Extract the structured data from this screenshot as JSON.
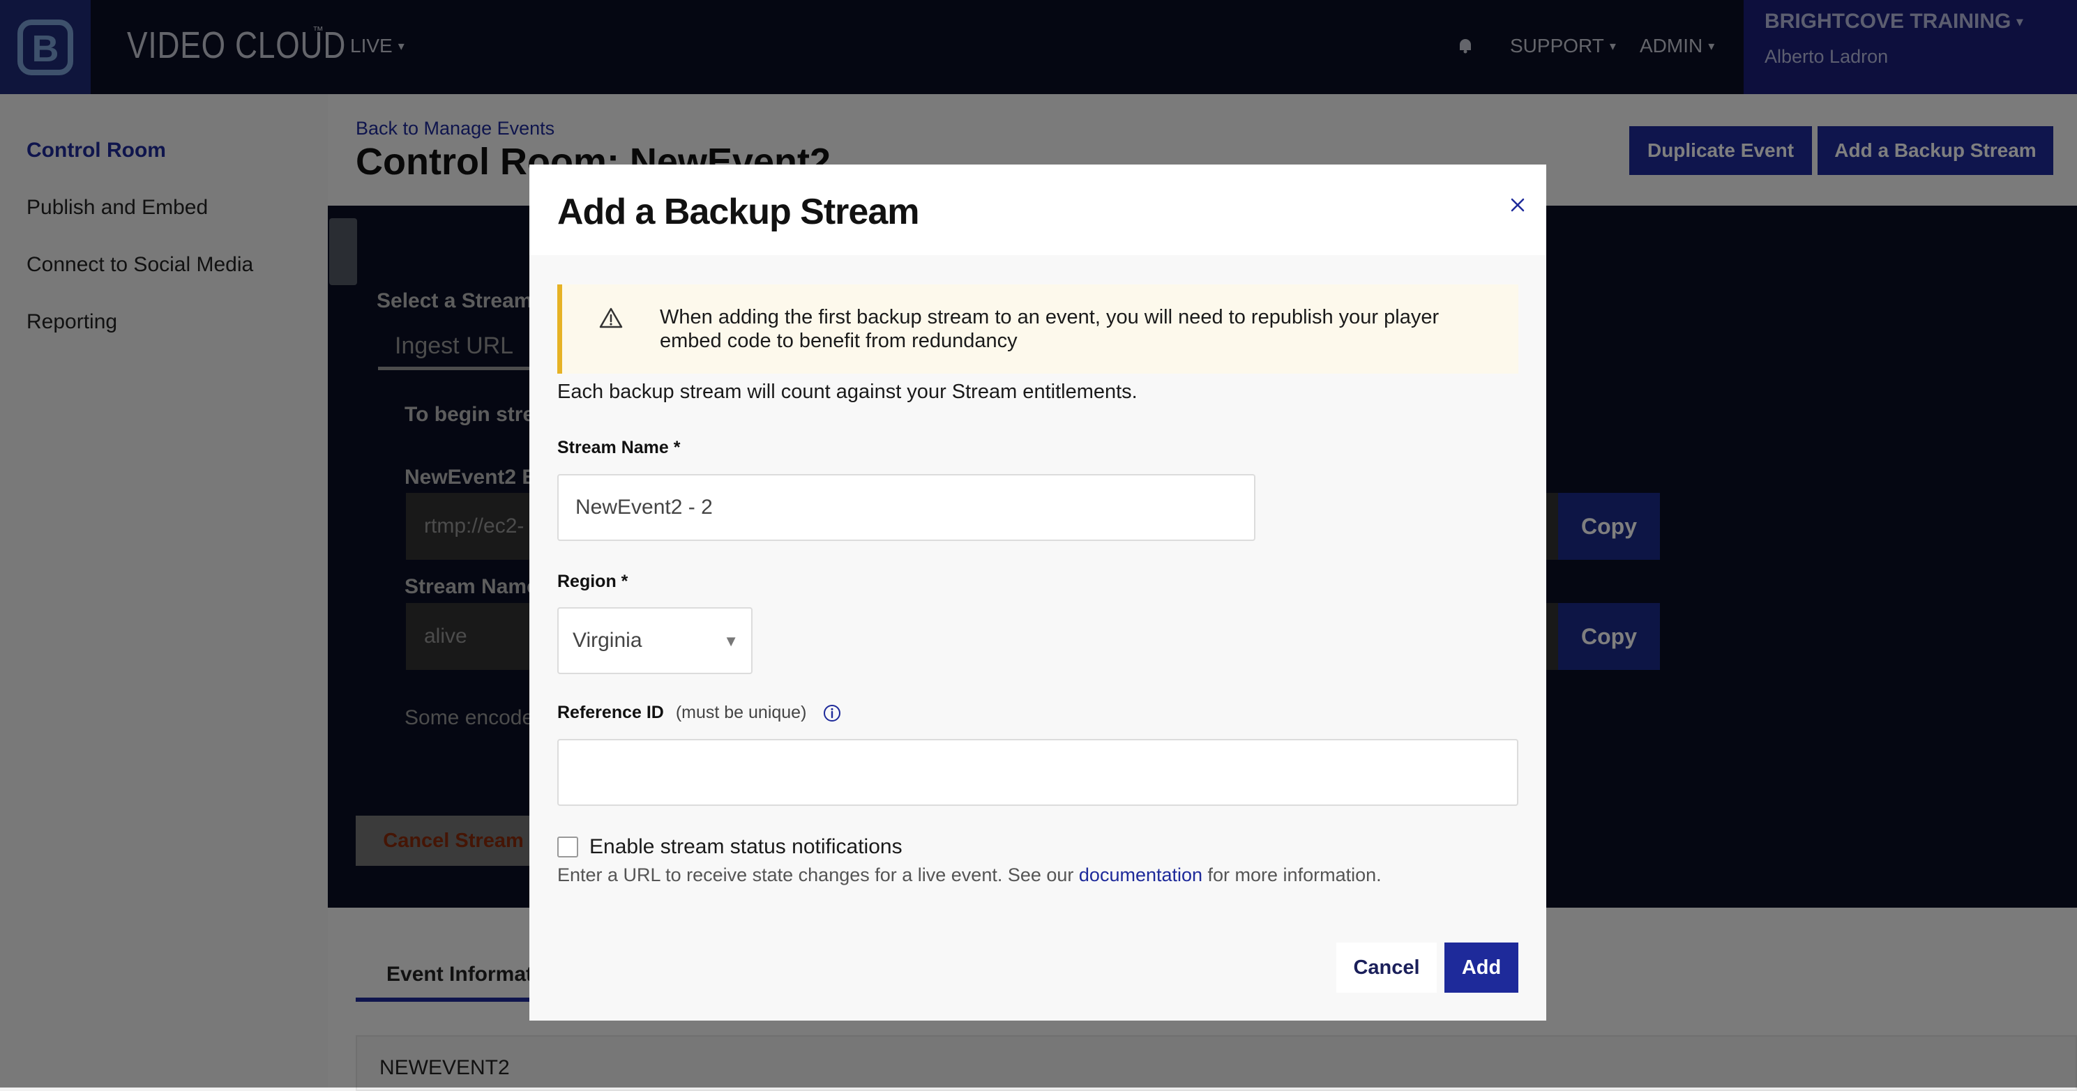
{
  "topbar": {
    "product_name": "VIDEO CLOUD",
    "product_tm": "™",
    "live_label": "LIVE",
    "support_label": "SUPPORT",
    "admin_label": "ADMIN",
    "account_name": "BRIGHTCOVE TRAINING",
    "user_name": "Alberto Ladron",
    "icons": [
      "brightcove-logo-icon",
      "bell-icon",
      "chevron-down-icon"
    ]
  },
  "sidebar": {
    "items": [
      {
        "label": "Control Room",
        "active": true
      },
      {
        "label": "Publish and Embed",
        "active": false
      },
      {
        "label": "Connect to Social Media",
        "active": false
      },
      {
        "label": "Reporting",
        "active": false
      }
    ]
  },
  "main": {
    "back_link": "Back to Manage Events",
    "title": "Control Room: NewEvent2",
    "duplicate_button": "Duplicate Event",
    "backup_button": "Add a Backup Stream",
    "panel": {
      "select_stream": "Select a Stream",
      "ingest_tab": "Ingest URL",
      "begin_text": "To begin streaming",
      "endpoint_label": "NewEvent2 Endpoint",
      "endpoint_value": "rtmp://ec2-",
      "stream_name_label": "Stream Name",
      "stream_name_value": "alive",
      "copy_label": "Copy",
      "encoders_text": "Some encoders",
      "cancel_stream": "Cancel Stream"
    },
    "event_info_tab": "Event Information",
    "event_name": "NEWEVENT2"
  },
  "modal": {
    "title": "Add a Backup Stream",
    "warning": "When adding the first backup stream to an event, you will need to republish your player embed code to benefit from redundancy",
    "entitlement_note": "Each backup stream will count against your Stream entitlements.",
    "stream_name_label": "Stream Name *",
    "stream_name_value": "NewEvent2 - 2",
    "region_label": "Region *",
    "region_value": "Virginia",
    "reference_label": "Reference ID",
    "reference_hint": "(must be unique)",
    "reference_value": "",
    "notify_label": "Enable stream status notifications",
    "notify_checked": false,
    "help_before": "Enter a URL to receive state changes for a live event. See our ",
    "help_link": "documentation",
    "help_after": " for more information.",
    "cancel_label": "Cancel",
    "add_label": "Add"
  },
  "colors": {
    "nav_bg": "#0a0f24",
    "accent": "#1e2a9a",
    "warning_border": "#e6b225",
    "warning_bg": "#fdf9ec"
  }
}
